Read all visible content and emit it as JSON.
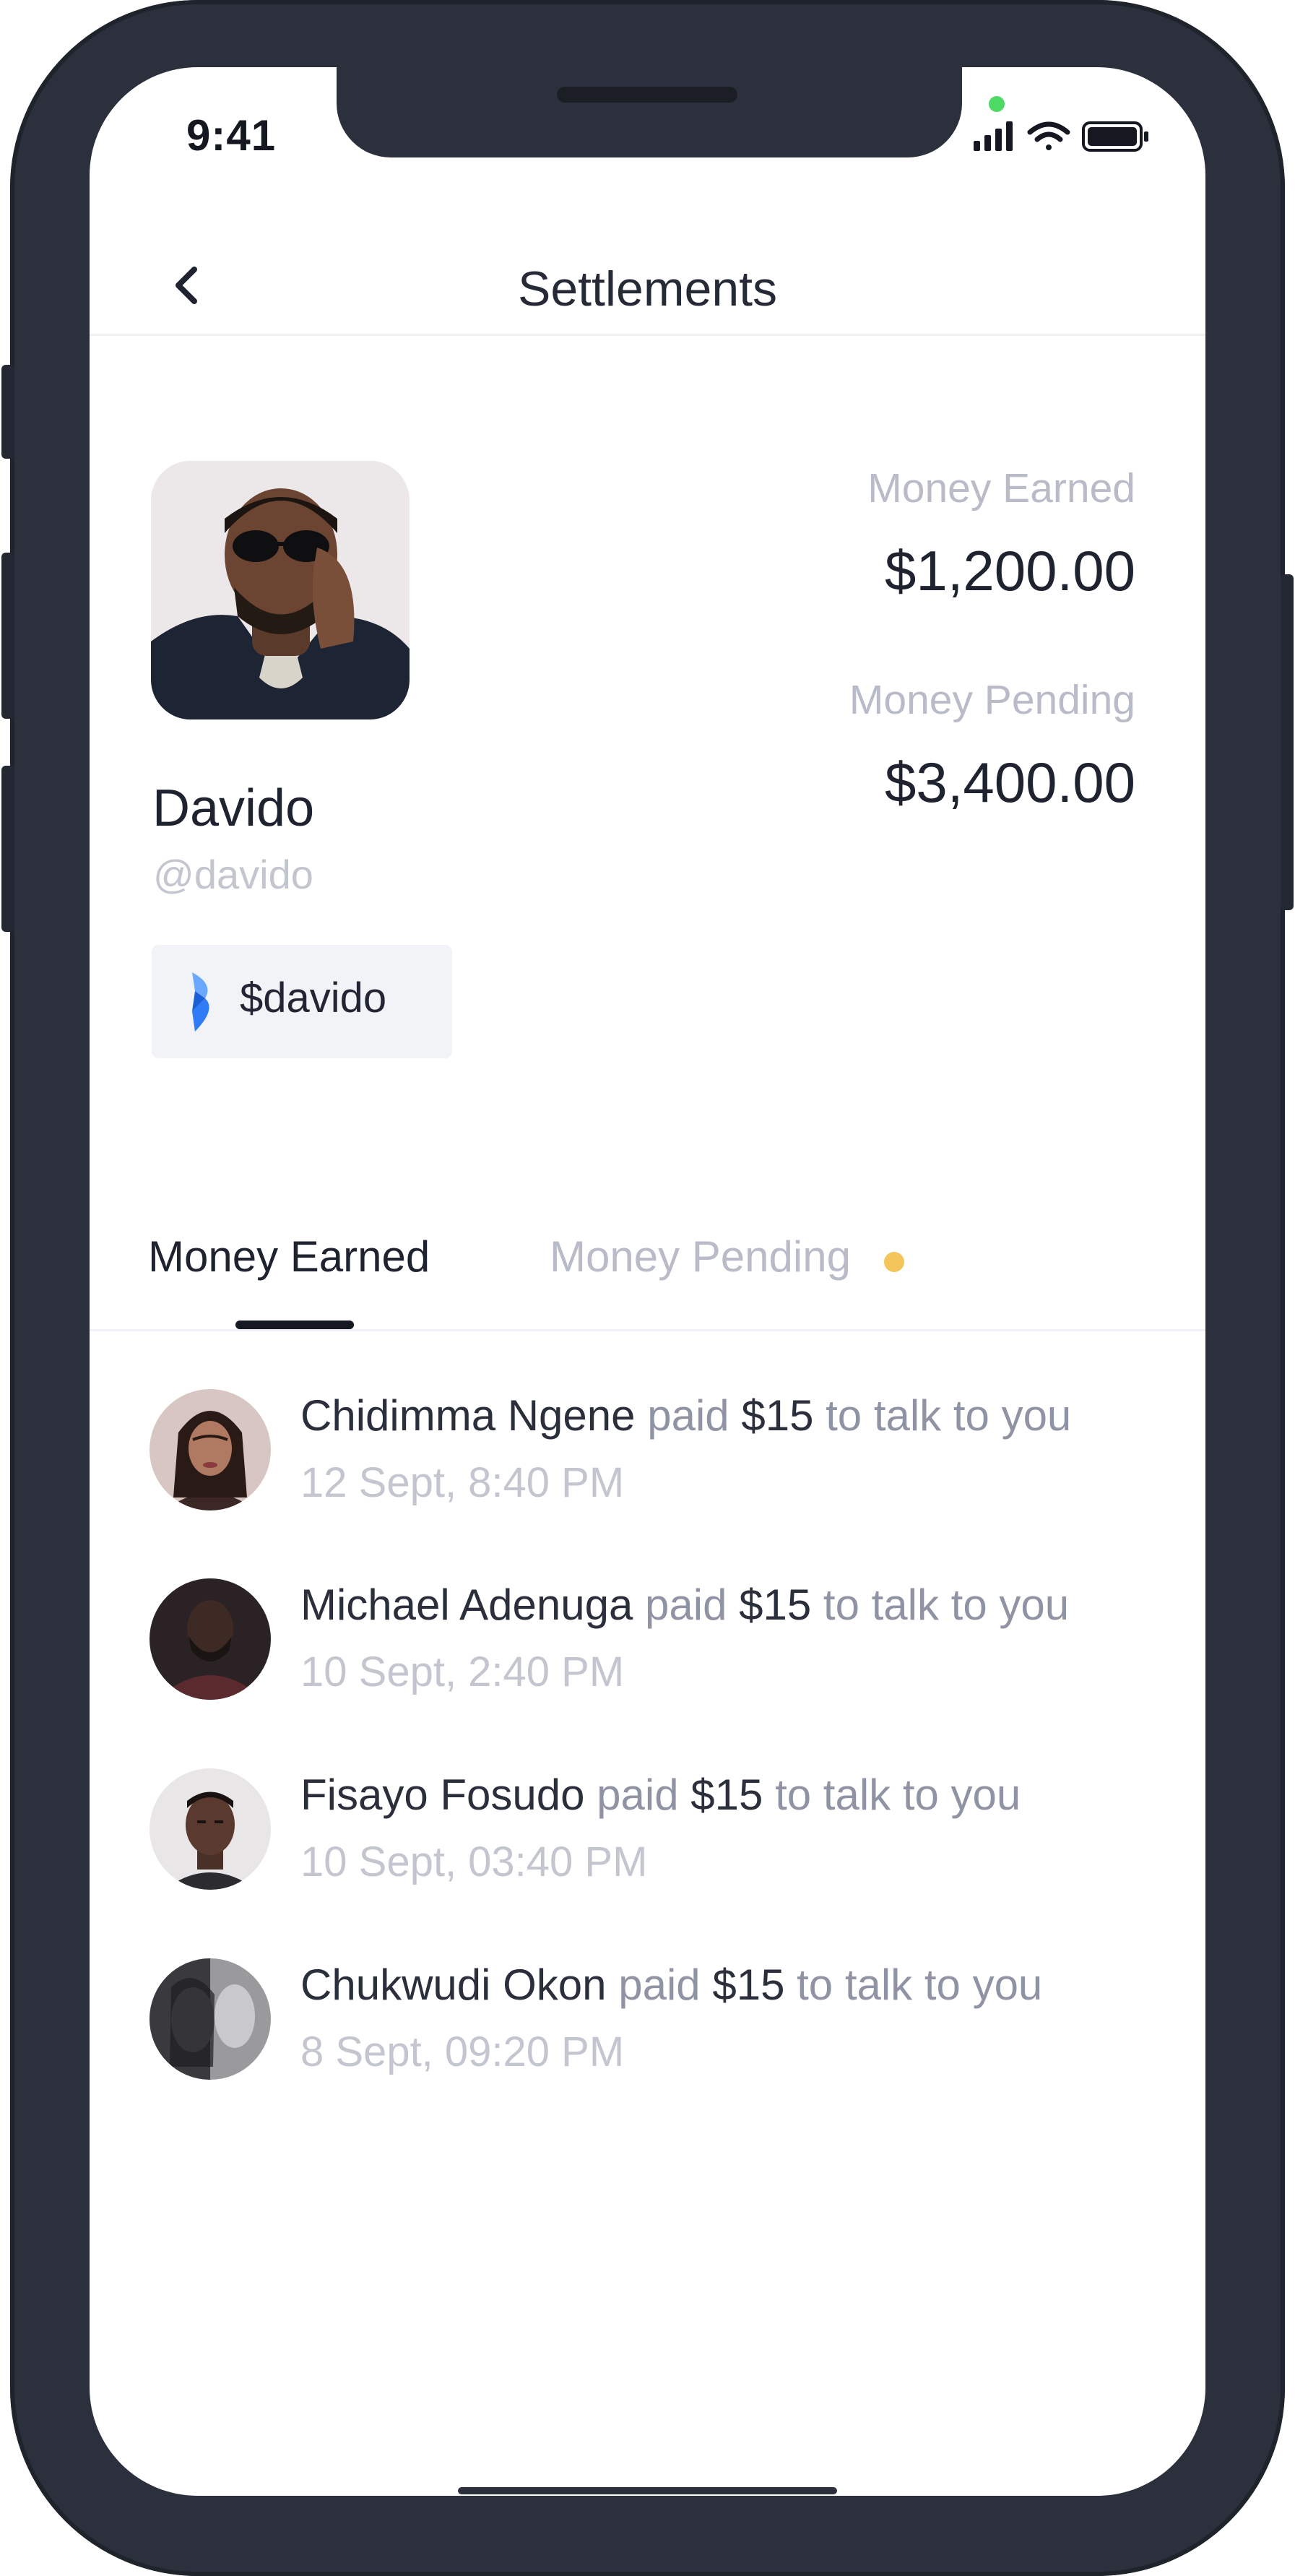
{
  "status_bar": {
    "time": "9:41",
    "icons": [
      "cellular-signal-icon",
      "wifi-icon",
      "battery-icon"
    ],
    "camera_indicator_color": "#4cd964"
  },
  "nav": {
    "title": "Settlements",
    "back_icon": "chevron-left-icon"
  },
  "profile": {
    "name": "Davido",
    "handle": "@davido",
    "tag": "$davido",
    "tag_icon": "app-logo-icon"
  },
  "stats": {
    "earned_label": "Money Earned",
    "earned_value": "$1,200.00",
    "pending_label": "Money Pending",
    "pending_value": "$3,400.00"
  },
  "tabs": [
    {
      "label": "Money Earned",
      "active": true
    },
    {
      "label": "Money Pending",
      "active": false,
      "indicator_color": "#f4c55b"
    }
  ],
  "transactions": [
    {
      "name": "Chidimma Ngene",
      "middle": " paid ",
      "amount": "$15",
      "suffix": " to talk to you",
      "time": "12 Sept, 8:40 PM"
    },
    {
      "name": "Michael Adenuga",
      "middle": " paid ",
      "amount": "$15",
      "suffix": " to talk to you",
      "time": "10 Sept, 2:40 PM"
    },
    {
      "name": "Fisayo Fosudo",
      "middle": " paid ",
      "amount": "$15",
      "suffix": " to talk to you",
      "time": "10 Sept, 03:40 PM"
    },
    {
      "name": "Chukwudi Okon",
      "middle": " paid ",
      "amount": "$15",
      "suffix": " to talk to you",
      "time": "8 Sept, 09:20 PM"
    }
  ],
  "colors": {
    "frame": "#2b303c",
    "text_primary": "#1f2330",
    "text_muted": "#b9bcc8",
    "pending_dot": "#f4c55b",
    "logo_blue": "#2f7cf6"
  }
}
